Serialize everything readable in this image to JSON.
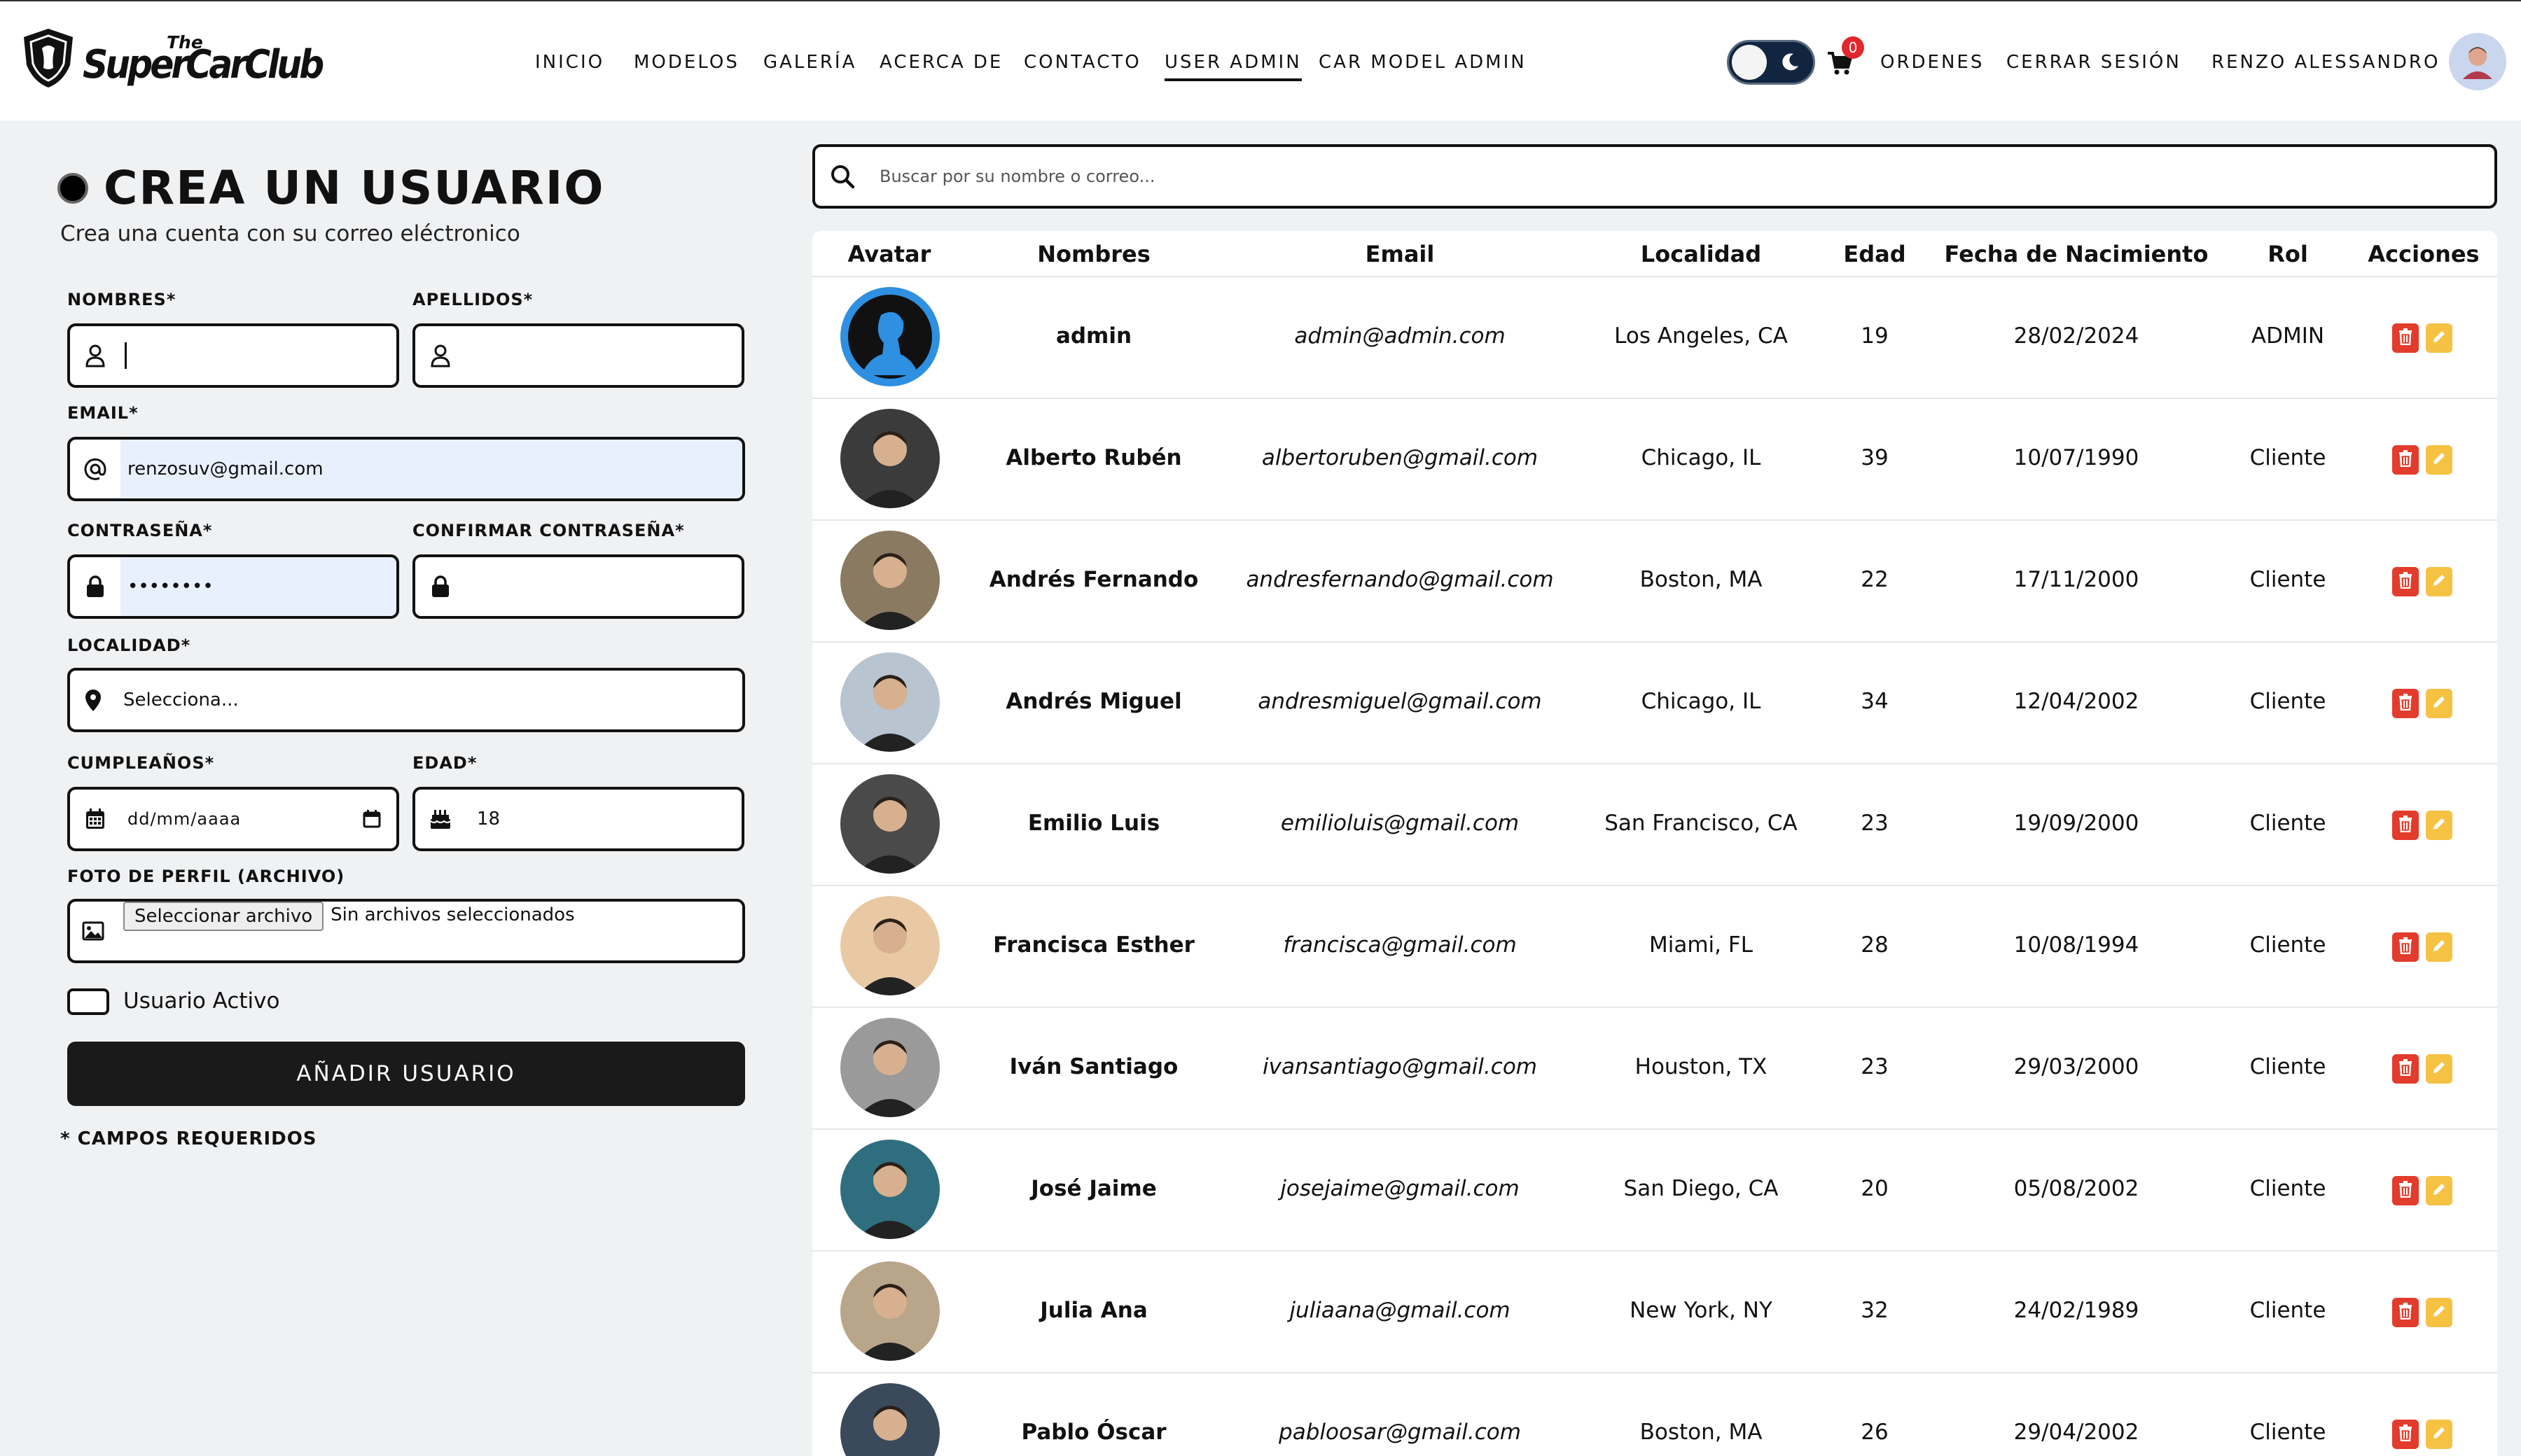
{
  "brand": {
    "the": "The",
    "name": "SuperCarClub"
  },
  "nav": {
    "items": [
      "INICIO",
      "MODELOS",
      "GALERÍA",
      "ACERCA DE",
      "CONTACTO",
      "USER ADMIN",
      "CAR MODEL ADMIN"
    ],
    "active": "USER ADMIN",
    "cart_count": "0",
    "orders": "ORDENES",
    "logout": "CERRAR SESIÓN",
    "user": "RENZO ALESSANDRO"
  },
  "form": {
    "title": "CREA UN USUARIO",
    "subtitle": "Crea una cuenta con su correo eléctronico",
    "nombres_label": "NOMBRES*",
    "apellidos_label": "APELLIDOS*",
    "email_label": "EMAIL*",
    "email_value": "renzosuv@gmail.com",
    "password_label": "CONTRASEÑA*",
    "password_value": "••••••••",
    "confirm_label": "CONFIRMAR CONTRASEÑA*",
    "localidad_label": "LOCALIDAD*",
    "localidad_value": "Selecciona...",
    "cumple_label": "CUMPLEAÑOS*",
    "cumple_placeholder": "dd/mm/aaaa",
    "edad_label": "EDAD*",
    "edad_value": "18",
    "foto_label": "FOTO DE PERFIL (ARCHIVO)",
    "file_button": "Seleccionar archivo",
    "file_none": "Sin archivos seleccionados",
    "activo_label": "Usuario Activo",
    "submit": "AÑADIR USUARIO",
    "required_note": "* CAMPOS REQUERIDOS"
  },
  "search": {
    "placeholder": "Buscar por su nombre o correo..."
  },
  "table": {
    "headers": [
      "Avatar",
      "Nombres",
      "Email",
      "Localidad",
      "Edad",
      "Fecha de Nacimiento",
      "Rol",
      "Acciones"
    ],
    "rows": [
      {
        "name": "admin",
        "email": "admin@admin.com",
        "loc": "Los Angeles, CA",
        "age": "19",
        "dob": "28/02/2024",
        "role": "ADMIN",
        "avatar_color": "#2f8fe0"
      },
      {
        "name": "Alberto Rubén",
        "email": "albertoruben@gmail.com",
        "loc": "Chicago, IL",
        "age": "39",
        "dob": "10/07/1990",
        "role": "Cliente",
        "avatar_color": "#3b3b3b"
      },
      {
        "name": "Andrés Fernando",
        "email": "andresfernando@gmail.com",
        "loc": "Boston, MA",
        "age": "22",
        "dob": "17/11/2000",
        "role": "Cliente",
        "avatar_color": "#8a7a62"
      },
      {
        "name": "Andrés Miguel",
        "email": "andresmiguel@gmail.com",
        "loc": "Chicago, IL",
        "age": "34",
        "dob": "12/04/2002",
        "role": "Cliente",
        "avatar_color": "#b8c4cf"
      },
      {
        "name": "Emilio Luis",
        "email": "emilioluis@gmail.com",
        "loc": "San Francisco, CA",
        "age": "23",
        "dob": "19/09/2000",
        "role": "Cliente",
        "avatar_color": "#4a4a4a"
      },
      {
        "name": "Francisca Esther",
        "email": "francisca@gmail.com",
        "loc": "Miami, FL",
        "age": "28",
        "dob": "10/08/1994",
        "role": "Cliente",
        "avatar_color": "#e8c9a4"
      },
      {
        "name": "Iván Santiago",
        "email": "ivansantiago@gmail.com",
        "loc": "Houston, TX",
        "age": "23",
        "dob": "29/03/2000",
        "role": "Cliente",
        "avatar_color": "#9a9a9a"
      },
      {
        "name": "José Jaime",
        "email": "josejaime@gmail.com",
        "loc": "San Diego, CA",
        "age": "20",
        "dob": "05/08/2002",
        "role": "Cliente",
        "avatar_color": "#2f6e7e"
      },
      {
        "name": "Julia Ana",
        "email": "juliaana@gmail.com",
        "loc": "New York, NY",
        "age": "32",
        "dob": "24/02/1989",
        "role": "Cliente",
        "avatar_color": "#b9a58a"
      },
      {
        "name": "Pablo Óscar",
        "email": "pabloosar@gmail.com",
        "loc": "Boston, MA",
        "age": "26",
        "dob": "29/04/2002",
        "role": "Cliente",
        "avatar_color": "#3a4a5a"
      }
    ]
  },
  "icons": {
    "user": "user-icon",
    "at": "at-icon",
    "lock": "lock-icon",
    "pin": "location-pin-icon",
    "calendar": "calendar-icon",
    "cake": "cake-icon",
    "image": "image-icon",
    "search": "search-icon",
    "cart": "cart-icon",
    "moon": "moon-icon",
    "trash": "trash-icon",
    "edit": "pencil-icon"
  }
}
